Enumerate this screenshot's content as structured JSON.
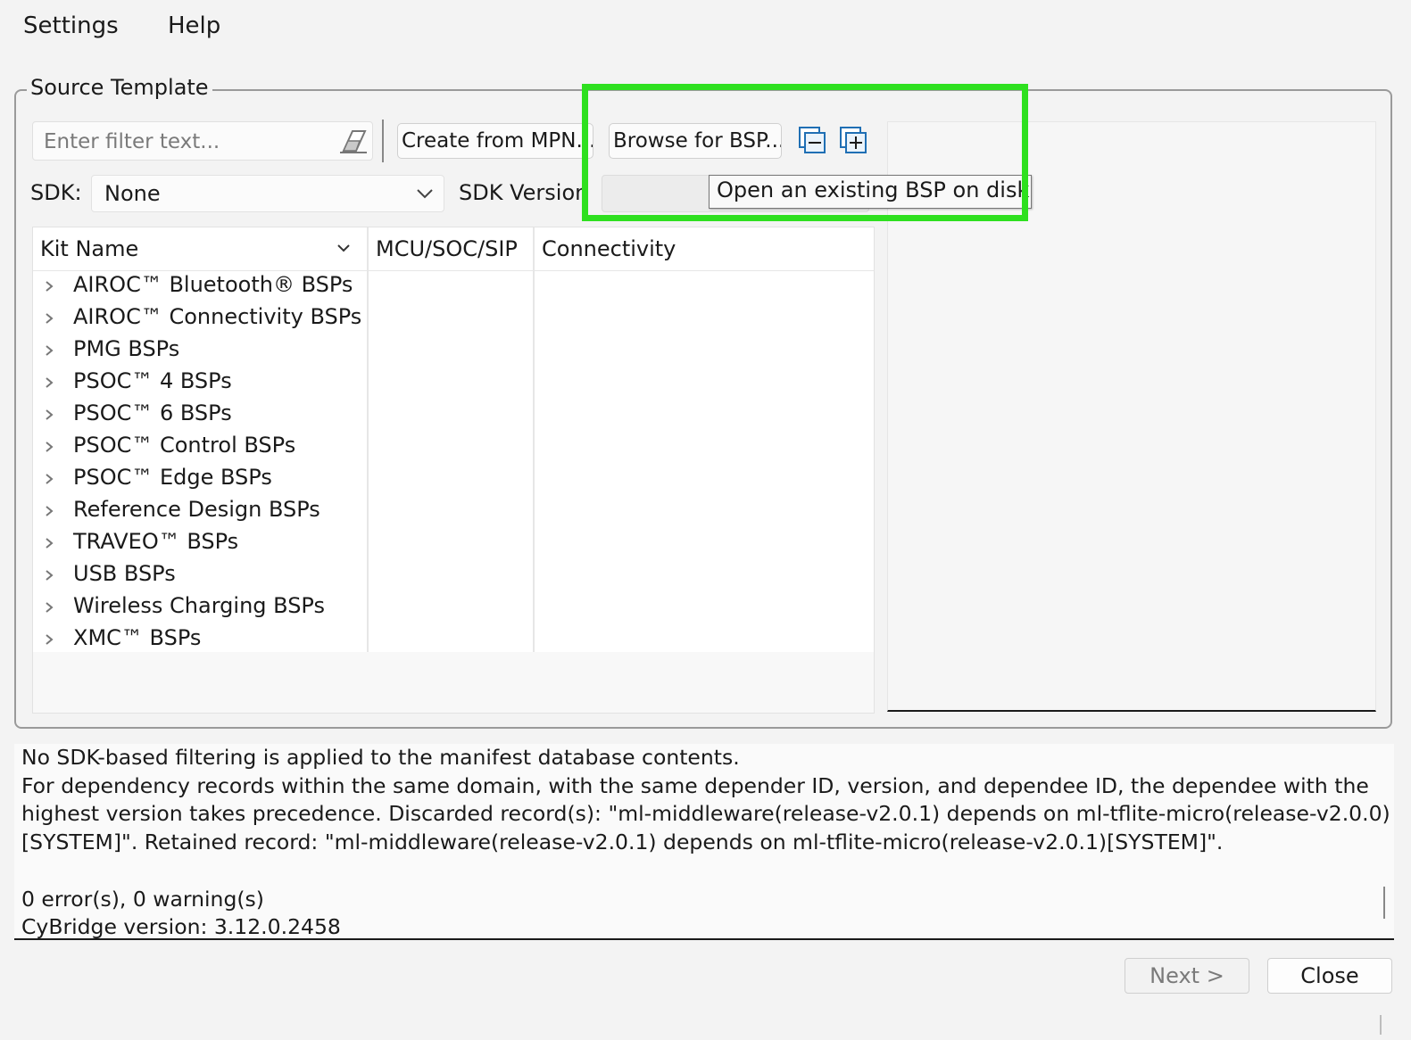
{
  "menu": {
    "settings": "Settings",
    "help": "Help"
  },
  "source_template": {
    "title": "Source Template",
    "filter": {
      "placeholder": "Enter filter text...",
      "value": ""
    },
    "buttons": {
      "create_from_mpn": "Create from MPN...",
      "browse_for_bsp": "Browse for BSP...",
      "collapse_all_icon": "collapse-all-icon",
      "expand_all_icon": "expand-all-icon"
    },
    "sdk_label": "SDK:",
    "sdk_value": "None",
    "sdk_version_label": "SDK Version",
    "sdk_version_value": "",
    "tooltip": "Open an existing BSP on disk.",
    "tree": {
      "columns": [
        "Kit Name",
        "MCU/SOC/SIP",
        "Connectivity"
      ],
      "rows": [
        "AIROC™ Bluetooth® BSPs",
        "AIROC™ Connectivity BSPs",
        "PMG BSPs",
        "PSOC™ 4 BSPs",
        "PSOC™ 6 BSPs",
        "PSOC™ Control BSPs",
        "PSOC™ Edge BSPs",
        "Reference Design BSPs",
        "TRAVEO™ BSPs",
        "USB BSPs",
        "Wireless Charging BSPs",
        "XMC™ BSPs"
      ]
    }
  },
  "log": {
    "lines": [
      "No SDK-based filtering is applied to the manifest database contents.",
      "For dependency records within the same domain, with the same depender ID, version, and dependee ID, the dependee with the",
      "highest version takes precedence. Discarded record(s): \"ml-middleware(release-v2.0.1) depends on ml-tflite-micro(release-v2.0.0)",
      "[SYSTEM]\". Retained record: \"ml-middleware(release-v2.0.1) depends on ml-tflite-micro(release-v2.0.1)[SYSTEM]\".",
      "",
      "0 error(s), 0 warning(s)",
      "CyBridge version: 3.12.0.2458"
    ]
  },
  "footer": {
    "next": "Next >",
    "close": "Close"
  },
  "colors": {
    "highlight": "#2ee01f",
    "icon_blue": "#1f6fb4"
  }
}
